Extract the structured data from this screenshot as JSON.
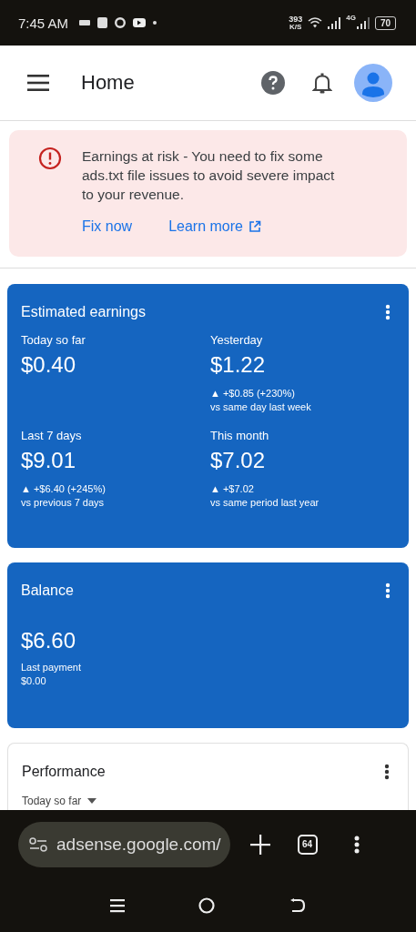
{
  "status_bar": {
    "time": "7:45 AM",
    "net_speed": "393",
    "net_unit": "K/S",
    "network_type": "4G",
    "battery": "70"
  },
  "header": {
    "title": "Home"
  },
  "alert": {
    "message": "Earnings at risk - You need to fix some ads.txt file issues to avoid severe impact to your revenue.",
    "actions": [
      "Fix now",
      "Learn more"
    ]
  },
  "earnings": {
    "title": "Estimated earnings",
    "stats": [
      {
        "label": "Today so far",
        "value": "$0.40"
      },
      {
        "label": "Yesterday",
        "value": "$1.22",
        "change": "▲ +$0.85 (+230%)",
        "comparison": "vs same day last week"
      },
      {
        "label": "Last 7 days",
        "value": "$9.01",
        "change": "▲ +$6.40 (+245%)",
        "comparison": "vs previous 7 days"
      },
      {
        "label": "This month",
        "value": "$7.02",
        "change": "▲ +$7.02",
        "comparison": "vs same period last year"
      }
    ]
  },
  "balance": {
    "title": "Balance",
    "value": "$6.60",
    "last_payment_label": "Last payment",
    "last_payment": "$0.00"
  },
  "performance": {
    "title": "Performance",
    "range": "Today so far"
  },
  "browser": {
    "url": "adsense.google.com/",
    "tab_count": "64"
  }
}
